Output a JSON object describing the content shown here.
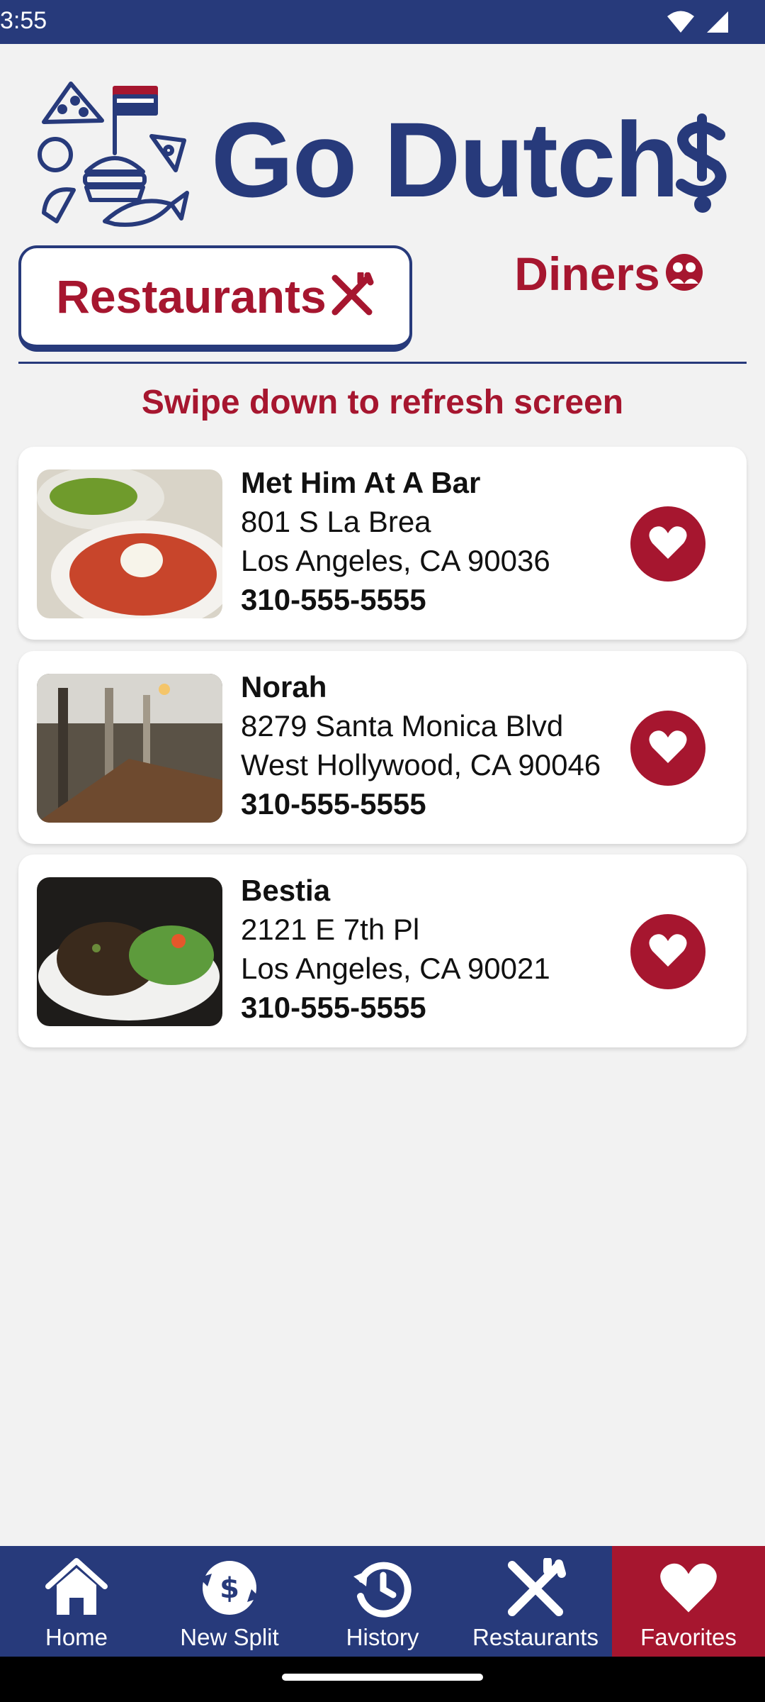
{
  "status_bar": {
    "time": "3:55",
    "icons": [
      "wifi-icon",
      "signal-icon"
    ]
  },
  "app": {
    "title": "Go Dutch",
    "logo": "food-flag-logo",
    "title_icon": "dollar-sign-icon"
  },
  "tabs": [
    {
      "label": "Restaurants",
      "icon": "fork-knife-icon",
      "selected": true
    },
    {
      "label": "Diners",
      "icon": "people-icon",
      "selected": false
    }
  ],
  "refresh_hint": "Swipe down to refresh screen",
  "restaurants": [
    {
      "name": "Met Him At A Bar",
      "address_line1": "801 S La Brea",
      "address_line2": "Los Angeles, CA 90036",
      "phone": "310-555-5555",
      "favorite": true,
      "photo": "pasta-with-burrata"
    },
    {
      "name": "Norah",
      "address_line1": "8279 Santa Monica Blvd",
      "address_line2": "West Hollywood, CA 90046",
      "phone": "310-555-5555",
      "favorite": true,
      "photo": "restaurant-interior"
    },
    {
      "name": "Bestia",
      "address_line1": "2121 E 7th Pl",
      "address_line2": "Los Angeles, CA 90021",
      "phone": "310-555-5555",
      "favorite": true,
      "photo": "grilled-meat-with-salad"
    }
  ],
  "bottom_nav": [
    {
      "label": "Home",
      "icon": "home-icon",
      "active": false
    },
    {
      "label": "New Split",
      "icon": "new-split-icon",
      "active": false
    },
    {
      "label": "History",
      "icon": "history-icon",
      "active": false
    },
    {
      "label": "Restaurants",
      "icon": "fork-knife-icon",
      "active": false
    },
    {
      "label": "Favorites",
      "icon": "heart-icon",
      "active": true
    }
  ],
  "colors": {
    "navy": "#273a7b",
    "crimson": "#a6162f",
    "background": "#f2f2f2"
  }
}
